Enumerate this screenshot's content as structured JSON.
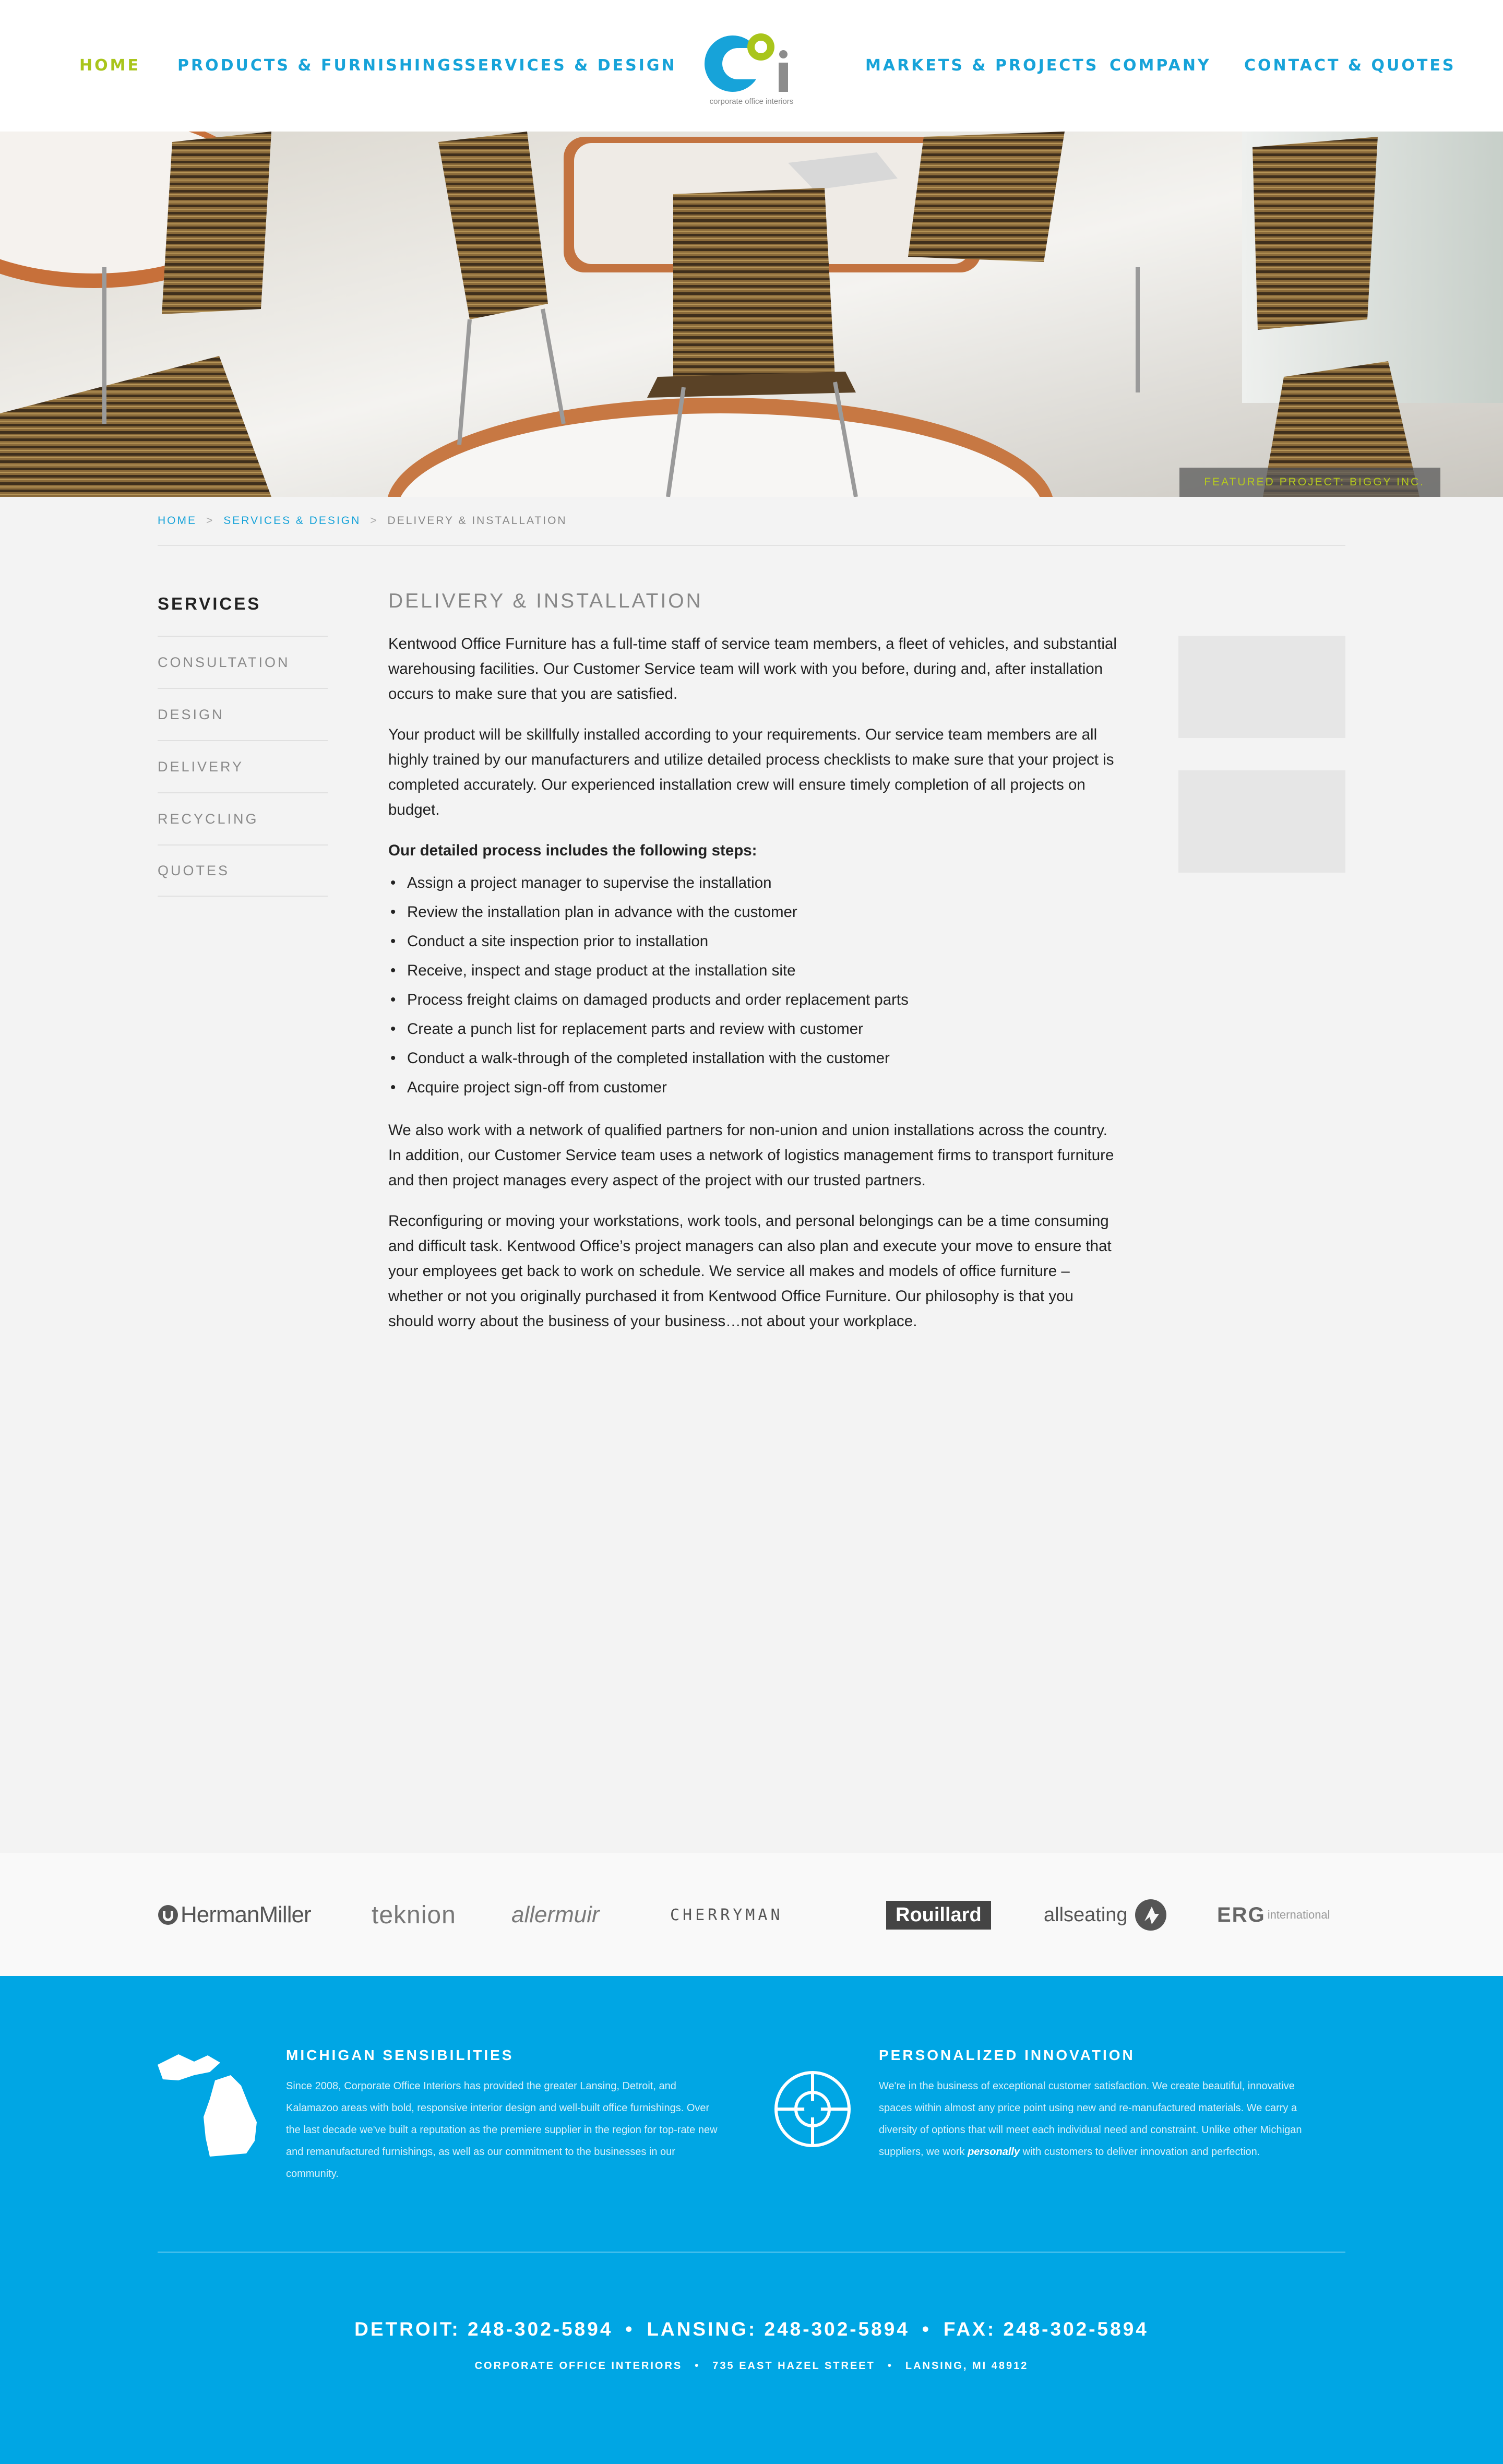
{
  "nav": {
    "home": "HOME",
    "products": "PRODUCTS & FURNISHINGS",
    "services": "SERVICES & DESIGN",
    "markets": "MARKETS & PROJECTS",
    "company": "COMPANY",
    "contact": "CONTACT & QUOTES"
  },
  "logo": {
    "letters": "COi",
    "caption": "corporate office interiors"
  },
  "hero": {
    "featured": "FEATURED PROJECT: BIGGY INC."
  },
  "breadcrumb": {
    "home": "HOME",
    "sep": ">",
    "services": "SERVICES & DESIGN",
    "current": "DELIVERY & INSTALLATION"
  },
  "sidebar": {
    "title": "SERVICES",
    "items": [
      "CONSULTATION",
      "DESIGN",
      "DELIVERY",
      "RECYCLING",
      "QUOTES"
    ]
  },
  "content": {
    "title": "DELIVERY & INSTALLATION",
    "p1": "Kentwood Office Furniture has a full-time staff of service team members, a fleet of vehicles, and substantial warehousing facilities.  Our Customer Service team will work with you before, during and, after installation occurs to make sure that you are satisfied.",
    "p2": "Your product will be skillfully installed according to your requirements. Our service team members are all highly trained by our manufacturers and utilize detailed process checklists to make sure that your project is completed accurately.  Our experienced installation crew will ensure timely completion of all projects on budget.",
    "steps_heading": "Our detailed process includes the following steps:",
    "steps": [
      "Assign a project manager to supervise the installation",
      "Review the installation plan in advance with the customer",
      "Conduct a site inspection prior to installation",
      "Receive, inspect and stage product at the installation site",
      "Process freight claims on damaged products and order replacement parts",
      "Create a punch list for replacement parts and review with customer",
      "Conduct a walk-through of the completed installation with the customer",
      "Acquire project sign-off from customer"
    ],
    "p3": "We also work with a network of qualified partners for non-union and union installations across the country.  In addition, our Customer Service team uses a network of logistics management firms to transport furniture and then project manages every aspect of the project with our trusted partners.",
    "p4": "Reconfiguring or moving your workstations, work tools, and personal belongings can be a time consuming and difficult task.  Kentwood Office’s project managers can also plan and execute your move to ensure that your employees get back to work on schedule.  We service all makes and models of office furniture – whether or not you originally purchased it from Kentwood Office Furniture.  Our philosophy is that you should worry about the business of your business…not about your workplace."
  },
  "brands": {
    "herman_miller": "HermanMiller",
    "teknion": "teknion",
    "allermuir": "allermuir",
    "cherryman": "CHERRYMAN",
    "rouillard": "Rouillard",
    "allseating": "allseating",
    "erg": "ERG",
    "erg_suffix": "international"
  },
  "footer": {
    "col1_title": "MICHIGAN SENSIBILITIES",
    "col1_text": "Since 2008, Corporate Office Interiors has provided the greater Lansing, Detroit, and Kalamazoo areas with bold, responsive interior design and well-built office furnishings. Over the last decade we've built a reputation as the premiere supplier in the region for top-rate new and remanufactured furnishings, as well as our commitment to the businesses in our community.",
    "col2_title": "PERSONALIZED INNOVATION",
    "col2_text_a": "We're in the business of exceptional customer satisfaction. We create beautiful, innovative spaces within almost any price point using new and re-manufactured materials. We carry a diversity of options that will meet each individual need and constraint. Unlike other Michigan suppliers, we work ",
    "col2_text_em": "personally",
    "col2_text_b": " with customers to deliver innovation and perfection.",
    "detroit": "DETROIT: 248-302-5894",
    "lansing": "LANSING: 248-302-5894",
    "fax": "FAX: 248-302-5894",
    "bullet": "•",
    "company": "CORPORATE OFFICE INTERIORS",
    "street": "735 EAST HAZEL STREET",
    "city": "LANSING, MI 48912"
  },
  "colors": {
    "accent_blue": "#17a3d9",
    "accent_green": "#a9c51b",
    "footer_blue": "#00a6e4",
    "page_bg": "#f3f3f3"
  }
}
